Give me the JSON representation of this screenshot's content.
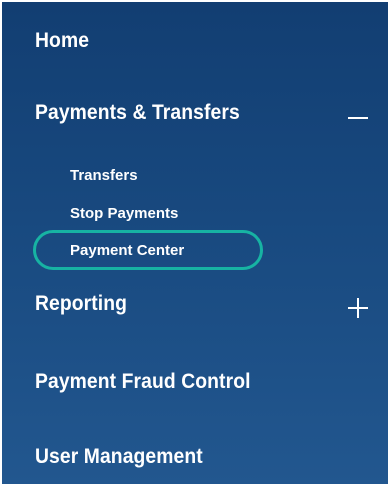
{
  "nav": {
    "home": "Home",
    "payments_transfers": {
      "label": "Payments & Transfers",
      "expanded": true,
      "toggle_icon": "minus-icon",
      "children": [
        {
          "label": "Transfers"
        },
        {
          "label": "Stop Payments"
        },
        {
          "label": "Payment Center",
          "highlighted": true
        }
      ]
    },
    "reporting": {
      "label": "Reporting",
      "expanded": false,
      "toggle_icon": "plus-icon"
    },
    "payment_fraud_control": "Payment Fraud Control",
    "user_management": "User Management"
  },
  "colors": {
    "nav_background_top": "#123e72",
    "nav_background_bottom": "#22578f",
    "text": "#ffffff",
    "highlight_ring": "#17b3a3"
  }
}
